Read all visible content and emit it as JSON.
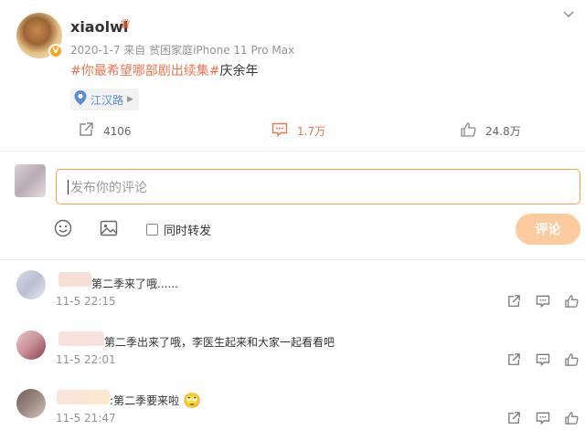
{
  "post": {
    "username": "xiaolwl",
    "crown_glyph": "♛",
    "vip_glyph": "V",
    "meta": "2020-1-7  来自 贫困家庭iPhone 11 Pro Max",
    "topic": "#你最希望哪部剧出续集#",
    "content_rest": "庆余年",
    "location": "江汉路",
    "stats": {
      "reposts": "4106",
      "comments": "1.7万",
      "likes": "24.8万"
    }
  },
  "composer": {
    "placeholder": "发布你的评论",
    "repost_label": "同时转发",
    "submit_label": "评论"
  },
  "comments": [
    {
      "text": "第二季来了哦......",
      "time": "11-5 22:15"
    },
    {
      "text": "第二季出来了哦，李医生起来和大家一起看看吧",
      "time": "11-5 22:01"
    },
    {
      "text": ":第二季要来啦",
      "emoji": "🙄",
      "time": "11-5 21:47"
    }
  ],
  "colors": {
    "accent": "#eb7350",
    "input_border": "#f0a04a",
    "submit_bg": "#fbcb9d",
    "link": "#5b8bd0"
  }
}
